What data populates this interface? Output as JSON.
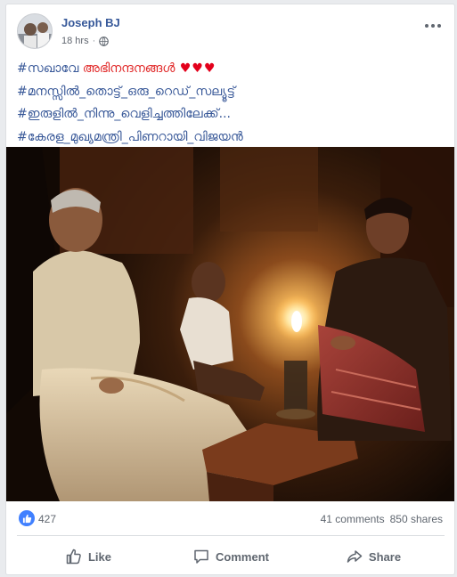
{
  "post": {
    "author": "Joseph BJ",
    "time": "18 hrs",
    "privacy_icon": "globe-icon",
    "text_lines": [
      {
        "pre": "#സഖാവേ ",
        "highlight": "അഭിനന്ദനങ്ങൾ",
        "hearts": " ♥♥♥"
      },
      {
        "text": "#മനസ്സിൽ_തൊട്ട്_ഒരു_റെഡ്_സല്യൂട്ട്"
      },
      {
        "text": "#ഇരുളിൽ_നിന്നു_വെളിച്ചത്തിലേക്ക്..."
      },
      {
        "text": "#കേരള_മുഖ്യമന്ത്രി_പിണറായി_വിജയൻ"
      }
    ]
  },
  "stats": {
    "likes": "427",
    "comments": "41 comments",
    "shares": "850 shares"
  },
  "actions": {
    "like": "Like",
    "comment": "Comment",
    "share": "Share"
  },
  "colors": {
    "link_blue": "#385898",
    "author_blue": "#365899",
    "highlight_red": "#e02424",
    "like_badge": "#4080ff"
  }
}
